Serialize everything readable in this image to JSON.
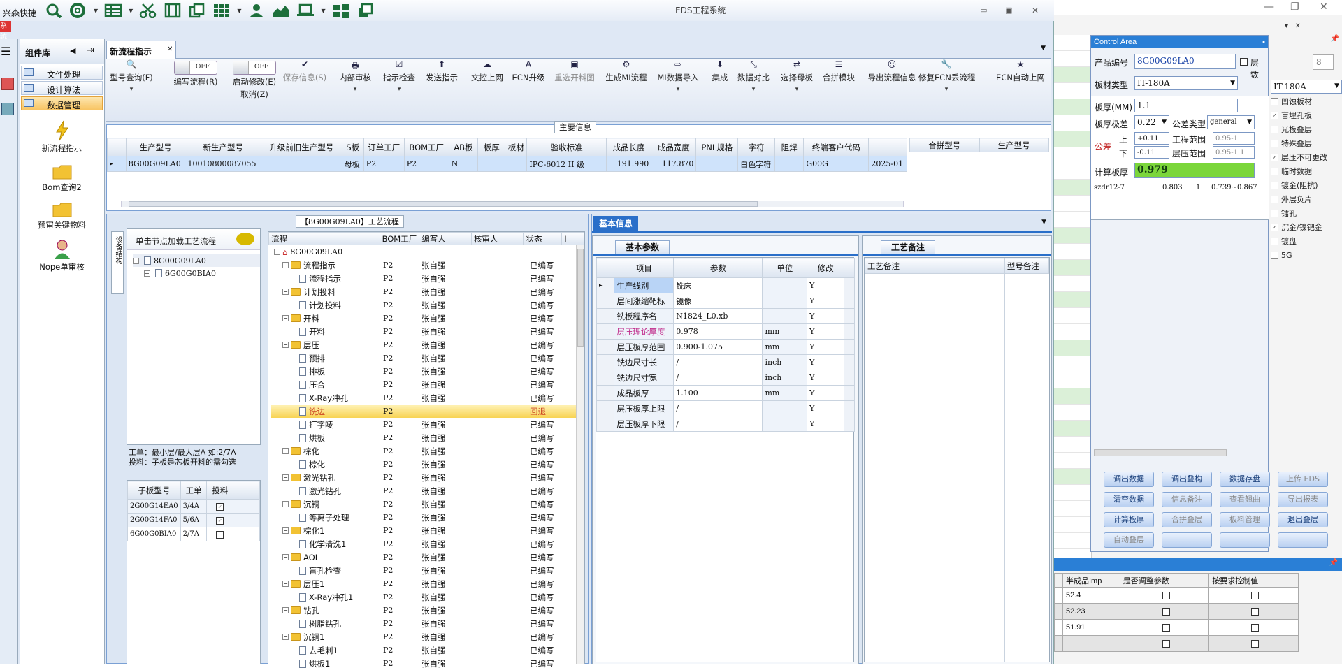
{
  "app": {
    "title": "EDS工程系统",
    "quicklaunch_label": "兴森快捷",
    "back_window_label": "系统"
  },
  "sidebar": {
    "title": "组件库",
    "items": [
      {
        "label": "文件处理"
      },
      {
        "label": "设计算法"
      },
      {
        "label": "数据管理"
      }
    ],
    "launchers": [
      {
        "label": "新流程指示",
        "icon": "lightning-icon"
      },
      {
        "label": "Bom查询2",
        "icon": "folder-icon"
      },
      {
        "label": "预审关键物料",
        "icon": "folder-icon"
      },
      {
        "label": "Nope单审核",
        "icon": "user-icon"
      }
    ]
  },
  "tab": {
    "label": "新流程指示"
  },
  "toolbar": {
    "buttons": [
      {
        "label": "型号查询(F)"
      },
      {
        "label": "编写流程(R)"
      },
      {
        "label": "启动修改(E)"
      },
      {
        "label": "保存信息(S)"
      },
      {
        "label": "内部审核"
      },
      {
        "label": "指示检查"
      },
      {
        "label": "发送指示"
      },
      {
        "label": "文控上网"
      },
      {
        "label": "ECN升级"
      },
      {
        "label": "重选开料图"
      },
      {
        "label": "生成MI流程"
      },
      {
        "label": "MI数据导入"
      },
      {
        "label": "集成"
      },
      {
        "label": "数据对比"
      },
      {
        "label": "选择母板"
      },
      {
        "label": "合拼模块"
      },
      {
        "label": "导出流程信息"
      },
      {
        "label": "修复ECN丢流程"
      },
      {
        "label": "ECN自动上网"
      }
    ],
    "toggle_off": "OFF",
    "cancel_label": "取消(Z)"
  },
  "main_info": {
    "title": "主要信息",
    "headers": [
      "生产型号",
      "新生产型号",
      "升级前旧生产型号",
      "S板",
      "订单工厂",
      "BOM工厂",
      "AB板",
      "板厚",
      "板材",
      "验收标准",
      "成品长度",
      "成品宽度",
      "PNL规格",
      "字符",
      "阻焊",
      "终端客户代码",
      ""
    ],
    "row": [
      "8G00G09LA0",
      "10010800087055",
      "",
      "母板",
      "P2",
      "P2",
      "N",
      "",
      "",
      "IPC-6012 II 级",
      "191.990",
      "117.870",
      "",
      "白色字符",
      "",
      "G00G",
      "2025-01"
    ],
    "side_headers": [
      "合拼型号",
      "生产型号"
    ]
  },
  "process": {
    "title": "【8G00G09LA0】工艺流程",
    "vtab": "设备结构",
    "click_hint": "单击节点加载工艺流程",
    "tree": [
      {
        "label": "8G00G09LA0",
        "level": 0
      },
      {
        "label": "6G00G0BIA0",
        "level": 1
      }
    ],
    "note1": "工单：最小层/最大层A 如:2/7A",
    "note2": "投料：子板是芯板开料的需勾选",
    "sub_headers": [
      "子板型号",
      "工单",
      "投料"
    ],
    "sub_rows": [
      {
        "model": "2G00G14EA0",
        "order": "3/4A",
        "feed": true
      },
      {
        "model": "2G00G14FA0",
        "order": "5/6A",
        "feed": true
      },
      {
        "model": "6G00G0BIA0",
        "order": "2/7A",
        "feed": false
      }
    ],
    "flow_headers": [
      "流程",
      "BOM工厂",
      "编写人",
      "核审人",
      "状态",
      "I"
    ],
    "flow_root": "8G00G09LA0",
    "flow_rows": [
      {
        "name": "流程指示",
        "level": 1,
        "folder": true,
        "bom": "P2",
        "writer": "张自强",
        "status": "已编写"
      },
      {
        "name": "流程指示",
        "level": 2,
        "folder": false,
        "bom": "P2",
        "writer": "张自强",
        "status": "已编写"
      },
      {
        "name": "计划投料",
        "level": 1,
        "folder": true,
        "bom": "P2",
        "writer": "张自强",
        "status": "已编写"
      },
      {
        "name": "计划投料",
        "level": 2,
        "folder": false,
        "bom": "P2",
        "writer": "张自强",
        "status": "已编写"
      },
      {
        "name": "开料",
        "level": 1,
        "folder": true,
        "bom": "P2",
        "writer": "张自强",
        "status": "已编写"
      },
      {
        "name": "开料",
        "level": 2,
        "folder": false,
        "bom": "P2",
        "writer": "张自强",
        "status": "已编写"
      },
      {
        "name": "层压",
        "level": 1,
        "folder": true,
        "bom": "P2",
        "writer": "张自强",
        "status": "已编写"
      },
      {
        "name": "预排",
        "level": 2,
        "folder": false,
        "bom": "P2",
        "writer": "张自强",
        "status": "已编写"
      },
      {
        "name": "排板",
        "level": 2,
        "folder": false,
        "bom": "P2",
        "writer": "张自强",
        "status": "已编写"
      },
      {
        "name": "压合",
        "level": 2,
        "folder": false,
        "bom": "P2",
        "writer": "张自强",
        "status": "已编写"
      },
      {
        "name": "X-Ray冲孔",
        "level": 2,
        "folder": false,
        "bom": "P2",
        "writer": "张自强",
        "status": "已编写"
      },
      {
        "name": "铣边",
        "level": 2,
        "folder": false,
        "bom": "P2",
        "writer": "",
        "status": "回退",
        "selected": true
      },
      {
        "name": "打字唛",
        "level": 2,
        "folder": false,
        "bom": "P2",
        "writer": "张自强",
        "status": "已编写"
      },
      {
        "name": "烘板",
        "level": 2,
        "folder": false,
        "bom": "P2",
        "writer": "张自强",
        "status": "已编写"
      },
      {
        "name": "棕化",
        "level": 1,
        "folder": true,
        "bom": "P2",
        "writer": "张自强",
        "status": "已编写"
      },
      {
        "name": "棕化",
        "level": 2,
        "folder": false,
        "bom": "P2",
        "writer": "张自强",
        "status": "已编写"
      },
      {
        "name": "激光钻孔",
        "level": 1,
        "folder": true,
        "bom": "P2",
        "writer": "张自强",
        "status": "已编写"
      },
      {
        "name": "激光钻孔",
        "level": 2,
        "folder": false,
        "bom": "P2",
        "writer": "张自强",
        "status": "已编写"
      },
      {
        "name": "沉铜",
        "level": 1,
        "folder": true,
        "bom": "P2",
        "writer": "张自强",
        "status": "已编写"
      },
      {
        "name": "等离子处理",
        "level": 2,
        "folder": false,
        "bom": "P2",
        "writer": "张自强",
        "status": "已编写"
      },
      {
        "name": "棕化1",
        "level": 1,
        "folder": true,
        "bom": "P2",
        "writer": "张自强",
        "status": "已编写"
      },
      {
        "name": "化学清洗1",
        "level": 2,
        "folder": false,
        "bom": "P2",
        "writer": "张自强",
        "status": "已编写"
      },
      {
        "name": "AOI",
        "level": 1,
        "folder": true,
        "bom": "P2",
        "writer": "张自强",
        "status": "已编写"
      },
      {
        "name": "盲孔检查",
        "level": 2,
        "folder": false,
        "bom": "P2",
        "writer": "张自强",
        "status": "已编写"
      },
      {
        "name": "层压1",
        "level": 1,
        "folder": true,
        "bom": "P2",
        "writer": "张自强",
        "status": "已编写"
      },
      {
        "name": "X-Ray冲孔1",
        "level": 2,
        "folder": false,
        "bom": "P2",
        "writer": "张自强",
        "status": "已编写"
      },
      {
        "name": "钻孔",
        "level": 1,
        "folder": true,
        "bom": "P2",
        "writer": "张自强",
        "status": "已编写"
      },
      {
        "name": "树脂钻孔",
        "level": 2,
        "folder": false,
        "bom": "P2",
        "writer": "张自强",
        "status": "已编写"
      },
      {
        "name": "沉铜1",
        "level": 1,
        "folder": true,
        "bom": "P2",
        "writer": "张自强",
        "status": "已编写"
      },
      {
        "name": "去毛刺1",
        "level": 2,
        "folder": false,
        "bom": "P2",
        "writer": "张自强",
        "status": "已编写"
      },
      {
        "name": "烘板1",
        "level": 2,
        "folder": false,
        "bom": "P2",
        "writer": "张自强",
        "status": "已编写"
      }
    ]
  },
  "basic": {
    "tab": "基本信息",
    "subtab": "基本参数",
    "headers": [
      "项目",
      "参数",
      "单位",
      "修改"
    ],
    "rows": [
      {
        "item": "生产线别",
        "param": "铣床",
        "unit": "",
        "mod": "Y",
        "hl": "sel"
      },
      {
        "item": "层间涨缩靶标",
        "param": "镜像",
        "unit": "",
        "mod": "Y"
      },
      {
        "item": "铣板程序名",
        "param": "N1824_L0.xb",
        "unit": "",
        "mod": "Y"
      },
      {
        "item": "层压理论厚度",
        "param": "0.978",
        "unit": "mm",
        "mod": "Y",
        "hl": "pink"
      },
      {
        "item": "层压板厚范围",
        "param": "0.900-1.075",
        "unit": "mm",
        "mod": "Y"
      },
      {
        "item": "铣边尺寸长",
        "param": "/",
        "unit": "inch",
        "mod": "Y"
      },
      {
        "item": "铣边尺寸宽",
        "param": "/",
        "unit": "inch",
        "mod": "Y"
      },
      {
        "item": "成品板厚",
        "param": "1.100",
        "unit": "mm",
        "mod": "Y"
      },
      {
        "item": "层压板厚上限",
        "param": "/",
        "unit": "",
        "mod": "Y"
      },
      {
        "item": "层压板厚下限",
        "param": "/",
        "unit": "",
        "mod": "Y"
      }
    ]
  },
  "remarks": {
    "tab": "工艺备注",
    "headers": [
      "工艺备注",
      "型号备注"
    ]
  },
  "control": {
    "title": "Control Area",
    "product_label": "产品编号",
    "product_value": "8G00G09LA0",
    "layers_label": "层  数",
    "layers_value": "8",
    "material_label": "板材类型",
    "material_value": "IT-180A",
    "material_value2": "IT-180A",
    "thick_label": "板厚(MM)",
    "thick_value": "1.1",
    "grade_label": "板厚极差",
    "grade_value": "0.22",
    "tol_type_label": "公差类型",
    "tol_type_value": "general",
    "tol_label": "公差",
    "up_label": "上",
    "down_label": "下",
    "up_value": "+0.11",
    "down_value": "-0.11",
    "eng_range_label": "工程范围",
    "eng_range_value": "0.95-1",
    "press_range_label": "层压范围",
    "press_range_value": "0.95-1.1",
    "calc_label": "计算板厚",
    "calc_value": "0.979",
    "list_row": [
      "szdr12-7",
      "0.803",
      "1",
      "0.739~0.867"
    ],
    "buttons": [
      {
        "label": "调出数据",
        "dis": false
      },
      {
        "label": "调出叠构",
        "dis": false
      },
      {
        "label": "数据存盘",
        "dis": false
      },
      {
        "label": "上传 EDS",
        "dis": true
      },
      {
        "label": "清空数据",
        "dis": false
      },
      {
        "label": "信息备注",
        "dis": true
      },
      {
        "label": "查看翘曲",
        "dis": true
      },
      {
        "label": "导出报表",
        "dis": true
      },
      {
        "label": "计算板厚",
        "dis": false
      },
      {
        "label": "合拼叠层",
        "dis": true
      },
      {
        "label": "板料管理",
        "dis": true
      },
      {
        "label": "退出叠层",
        "dis": false
      },
      {
        "label": "自动叠层",
        "dis": true
      },
      {
        "label": "",
        "dis": false
      },
      {
        "label": "",
        "dis": false
      },
      {
        "label": "",
        "dis": false
      }
    ]
  },
  "right_options": [
    {
      "label": "凹蚀板材",
      "checked": false
    },
    {
      "label": "盲埋孔板",
      "checked": true
    },
    {
      "label": "光板叠层",
      "checked": false
    },
    {
      "label": "特殊叠层",
      "checked": false
    },
    {
      "label": "层压不可更改",
      "checked": true
    },
    {
      "label": "临时数据",
      "checked": false
    },
    {
      "label": "镀金(阻抗)",
      "checked": false
    },
    {
      "label": "外层负片",
      "checked": false
    },
    {
      "label": "镭孔",
      "checked": false
    },
    {
      "label": "沉金/镍钯金",
      "checked": true
    },
    {
      "label": "镀盘",
      "checked": false
    },
    {
      "label": "5G",
      "checked": false
    }
  ],
  "bottom_table": {
    "headers": [
      "",
      "半成品Imp",
      "是否调整参数",
      "按要求控制值"
    ],
    "rows": [
      [
        "",
        "52.4"
      ],
      [
        "",
        "52.23"
      ],
      [
        "",
        "51.91"
      ],
      [
        "",
        ""
      ]
    ]
  }
}
